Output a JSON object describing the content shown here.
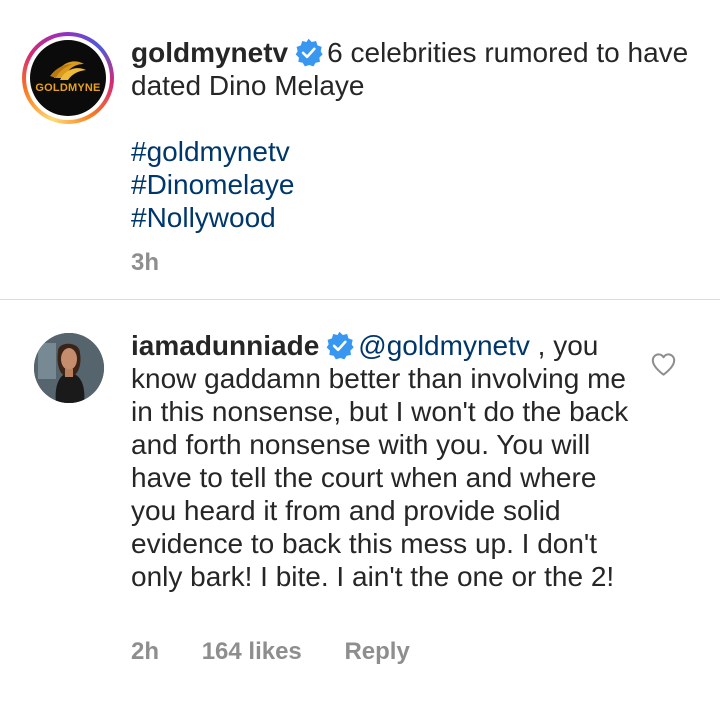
{
  "post": {
    "username": "goldmynetv",
    "logo_text": "GOLDMYNE",
    "caption": "6 celebrities rumored to have dated Dino Melaye",
    "hashtags": [
      "#goldmynetv",
      "#Dinomelaye",
      "#Nollywood"
    ],
    "time": "3h"
  },
  "comment": {
    "username": "iamadunniade",
    "mention": "@goldmynetv",
    "text": " , you know gaddamn better than involving me in this nonsense, but I won't do the back and forth nonsense with you. You will have to tell the court when and where you heard it from and provide solid evidence to back this mess up. I don't only bark! I bite. I ain't the one or the 2!",
    "time": "2h",
    "likes": "164 likes",
    "reply_label": "Reply"
  },
  "icons": {
    "verified": "verified-badge-icon",
    "like": "heart-outline-icon"
  },
  "colors": {
    "link": "#00376b",
    "verified": "#3897f0",
    "meta": "#8e8e8e"
  }
}
